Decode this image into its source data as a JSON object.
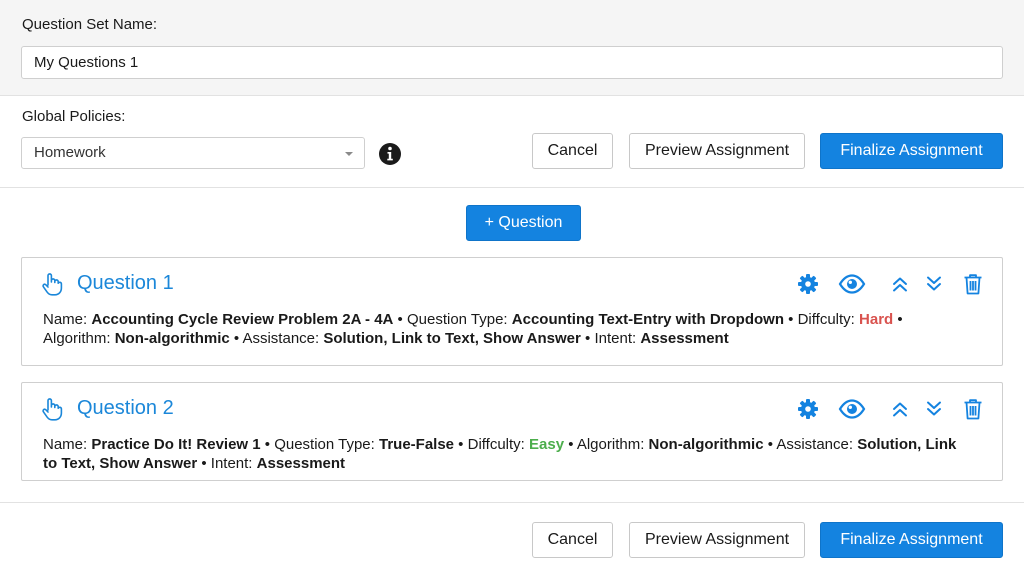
{
  "question_set": {
    "label": "Question Set Name:",
    "value": "My Questions 1"
  },
  "policies": {
    "label": "Global Policies:",
    "selected": "Homework",
    "info_icon": "info-circle-icon"
  },
  "actions": {
    "cancel": "Cancel",
    "preview": "Preview Assignment",
    "finalize": "Finalize Assignment",
    "add_question": "+ Question"
  },
  "field_labels": {
    "name": "Name:",
    "type": "Question Type:",
    "difficulty": "Diffculty:",
    "algorithm": "Algorithm:",
    "assistance": "Assistance:",
    "intent": "Intent:"
  },
  "questions": [
    {
      "title": "Question 1",
      "name": "Accounting Cycle Review Problem 2A - 4A",
      "type": "Accounting Text-Entry with Dropdown",
      "difficulty": "Hard",
      "algorithm": "Non-algorithmic",
      "assistance": "Solution, Link to Text, Show Answer",
      "intent": "Assessment"
    },
    {
      "title": "Question 2",
      "name": "Practice Do It! Review 1",
      "type": "True-False",
      "difficulty": "Easy",
      "algorithm": "Non-algorithmic",
      "assistance": "Solution, Link to Text, Show Answer",
      "intent": "Assessment"
    }
  ],
  "colors": {
    "primary": "#1483e0",
    "title_blue": "#1b87d9",
    "hard": "#d9534f",
    "easy": "#4cae4c"
  },
  "icons": [
    "hand-pointer-icon",
    "gear-icon",
    "eye-icon",
    "double-chevron-up-icon",
    "double-chevron-down-icon",
    "trash-icon"
  ]
}
